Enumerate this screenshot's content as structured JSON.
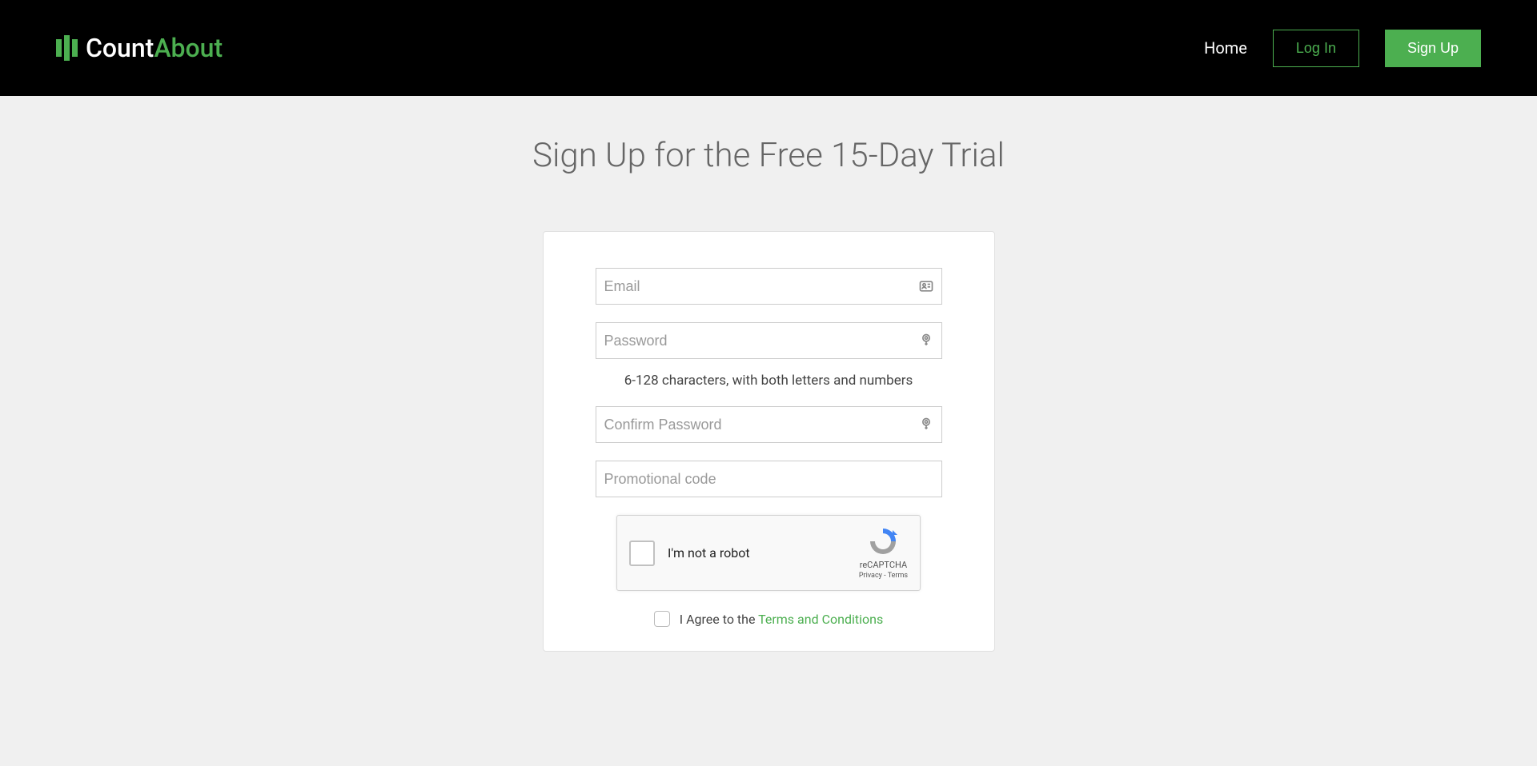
{
  "header": {
    "logo": {
      "text1": "Count",
      "text2": "About"
    },
    "nav": {
      "home": "Home",
      "login": "Log In",
      "signup": "Sign Up"
    }
  },
  "page": {
    "title": "Sign Up for the Free 15-Day Trial"
  },
  "form": {
    "email_placeholder": "Email",
    "password_placeholder": "Password",
    "password_hint": "6-128 characters, with both letters and numbers",
    "confirm_password_placeholder": "Confirm Password",
    "promo_placeholder": "Promotional code"
  },
  "recaptcha": {
    "label": "I'm not a robot",
    "brand": "reCAPTCHA",
    "links": "Privacy - Terms"
  },
  "terms": {
    "prefix": "I Agree to the ",
    "link_text": "Terms and Conditions"
  }
}
